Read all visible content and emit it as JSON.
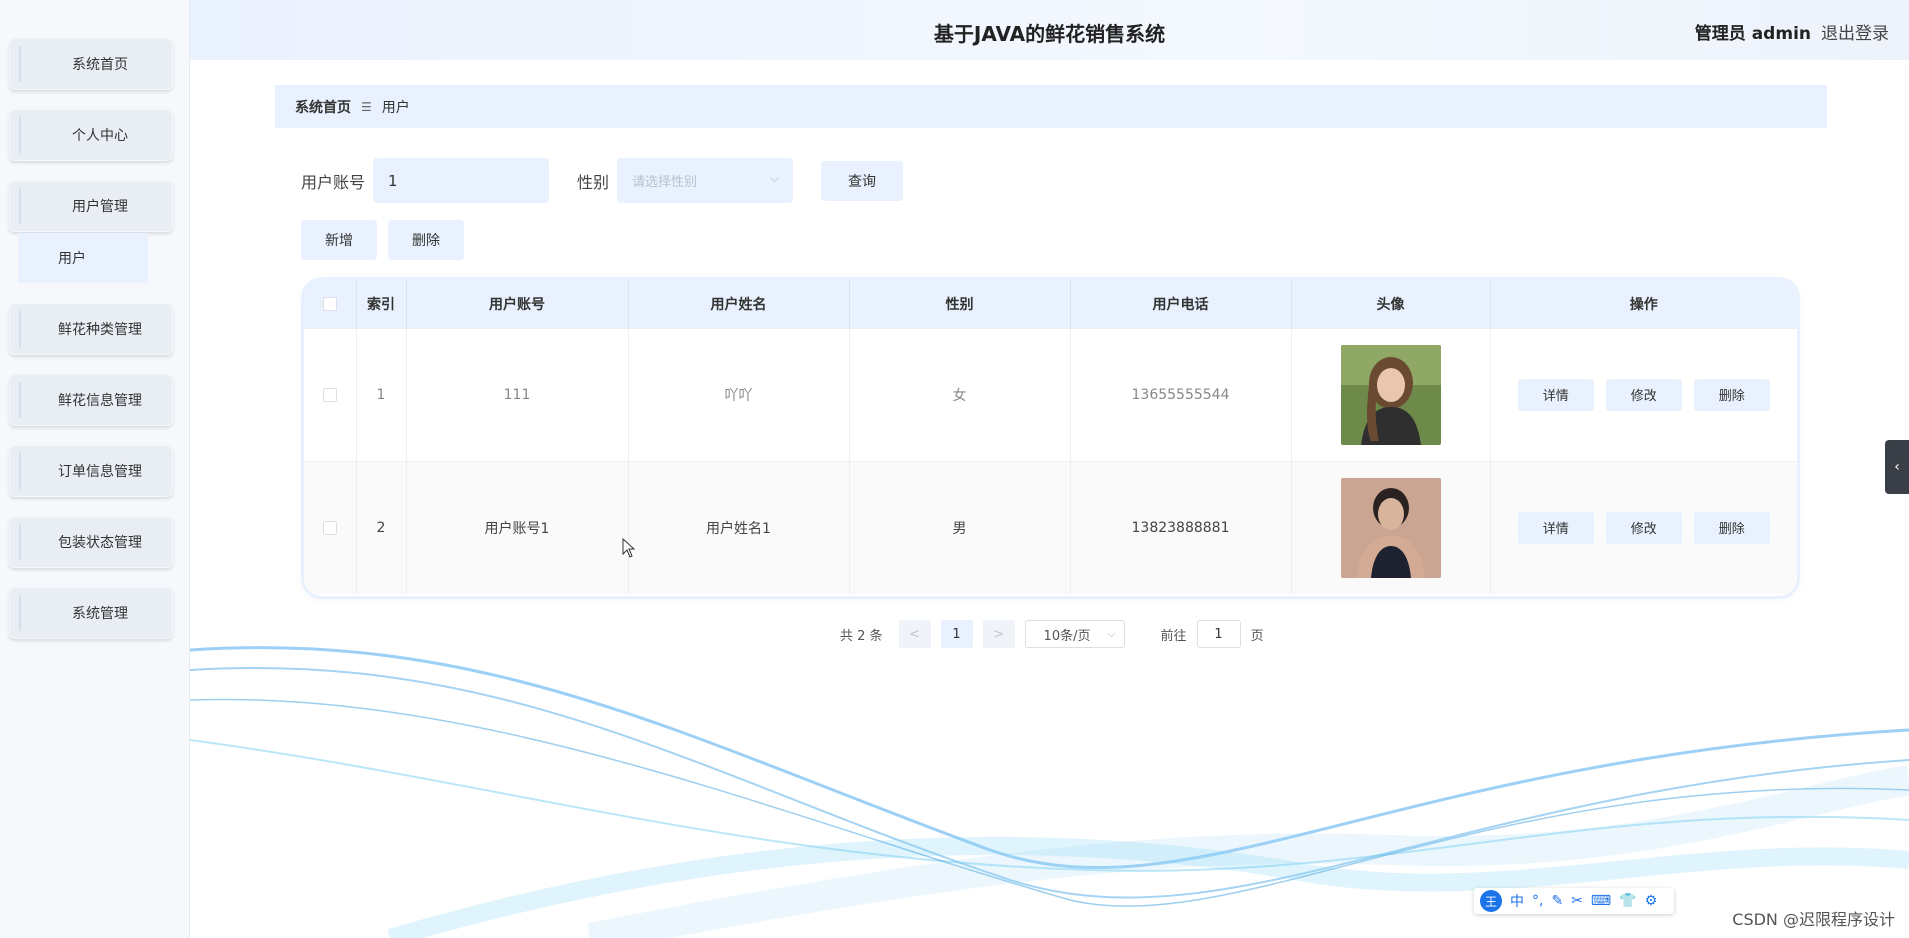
{
  "header": {
    "title": "基于JAVA的鲜花销售系统",
    "user": "管理员 admin",
    "logout": "退出登录"
  },
  "sidebar": {
    "items": [
      {
        "label": "系统首页"
      },
      {
        "label": "个人中心"
      },
      {
        "label": "用户管理"
      },
      {
        "label": "鲜花种类管理"
      },
      {
        "label": "鲜花信息管理"
      },
      {
        "label": "订单信息管理"
      },
      {
        "label": "包装状态管理"
      },
      {
        "label": "系统管理"
      }
    ],
    "submenu": {
      "label": "用户"
    }
  },
  "breadcrumb": {
    "home": "系统首页",
    "separator": "☰",
    "current": "用户"
  },
  "search": {
    "account_label": "用户账号",
    "account_value": "1",
    "gender_label": "性别",
    "gender_placeholder": "请选择性别",
    "query_label": "查询"
  },
  "actions": {
    "add": "新增",
    "delete": "删除"
  },
  "table": {
    "columns": [
      "索引",
      "用户账号",
      "用户姓名",
      "性别",
      "用户电话",
      "头像",
      "操作"
    ],
    "rows": [
      {
        "index": "1",
        "account": "111",
        "name": "吖吖",
        "gender": "女",
        "phone": "13655555544"
      },
      {
        "index": "2",
        "account": "用户账号1",
        "name": "用户姓名1",
        "gender": "男",
        "phone": "13823888881"
      }
    ],
    "op_labels": {
      "detail": "详情",
      "edit": "修改",
      "delete": "删除"
    }
  },
  "pagination": {
    "total": "共 2 条",
    "prev": "<",
    "page": "1",
    "next": ">",
    "size": "10条/页",
    "goto": "前往",
    "goto_value": "1",
    "page_unit": "页"
  },
  "ime": {
    "logo": "王",
    "mode": "中"
  },
  "watermark": "CSDN @迟限程序设计",
  "colors": {
    "accent_bg": "#e8f1fd",
    "sidebar_bg": "#f6f8fc",
    "wave": "#4aa8e8"
  }
}
